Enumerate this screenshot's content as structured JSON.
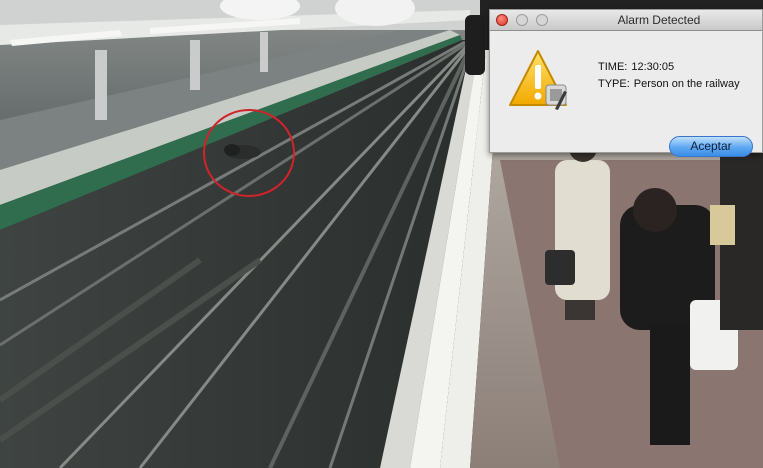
{
  "dialog": {
    "title": "Alarm Detected",
    "time_label": "TIME:",
    "time_value": "12:30:05",
    "type_label": "TYPE:",
    "type_value": "Person on the railway",
    "ok_button": "Aceptar"
  },
  "colors": {
    "alarm_circle": "#d2232a",
    "button_accent": "#3a8ce6",
    "close_button": "#d8362a"
  },
  "icons": {
    "dialog_icon": "warning-triangle-icon"
  }
}
